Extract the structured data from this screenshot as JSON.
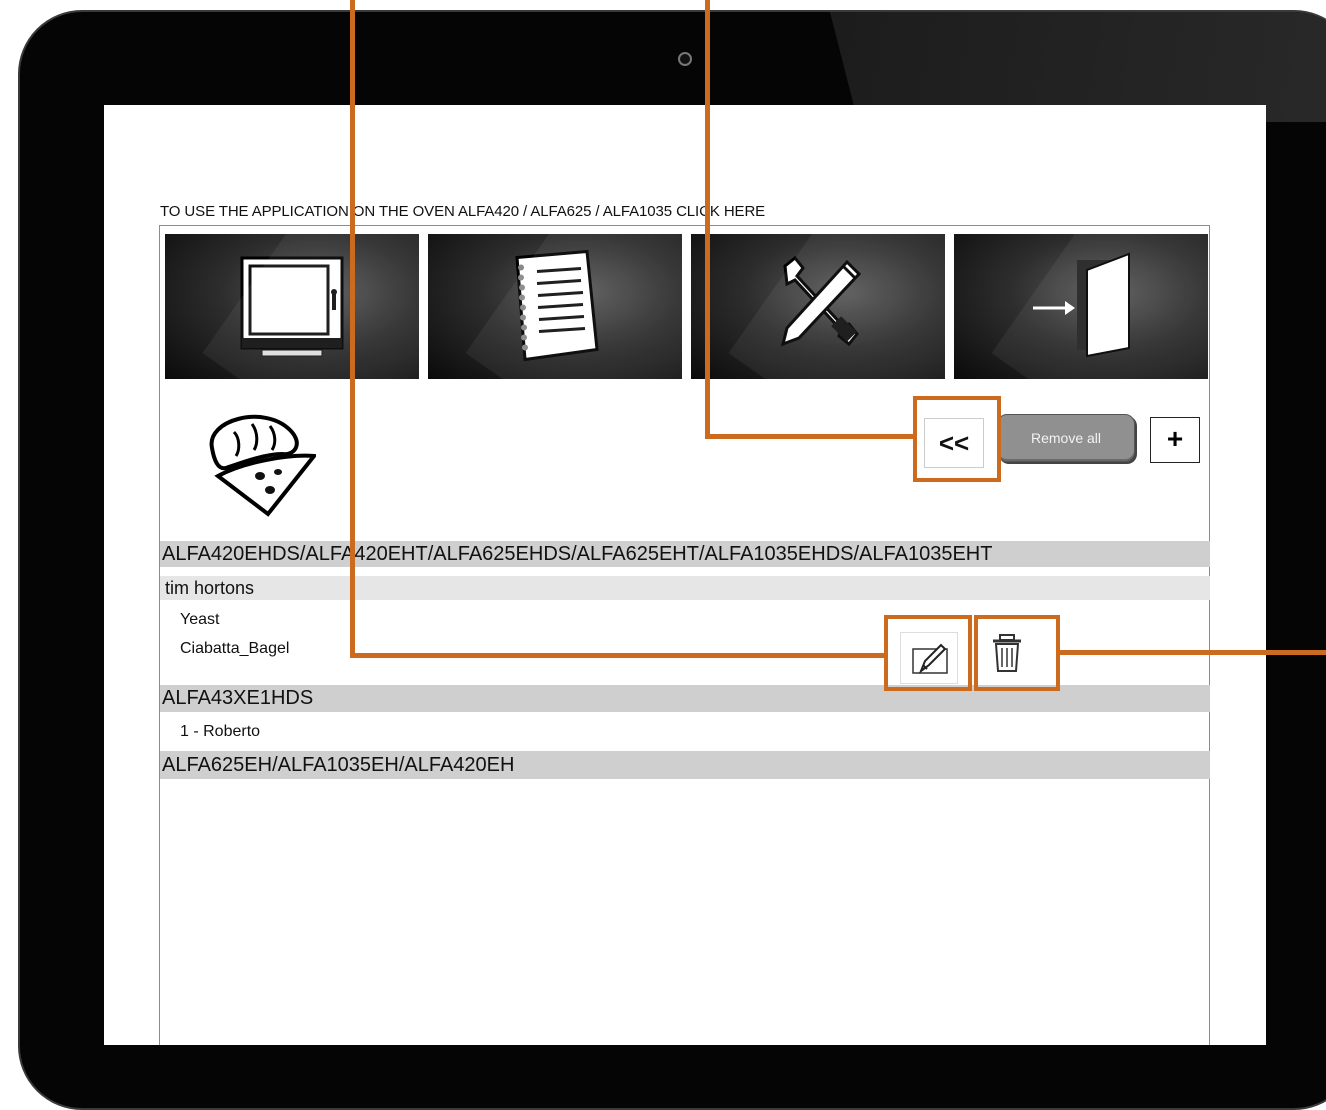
{
  "notice": {
    "text": "TO USE THE APPLICATION ON THE OVEN ALFA420 / ALFA625 / ALFA1035 CLICK HERE"
  },
  "toolbar": {
    "tiles": [
      {
        "icon": "oven-icon"
      },
      {
        "icon": "notebook-icon"
      },
      {
        "icon": "tools-icon"
      },
      {
        "icon": "exit-door-icon"
      }
    ]
  },
  "category": {
    "icon": "bread-pizza-icon"
  },
  "actions": {
    "back_label": "<<",
    "remove_all_label": "Remove all",
    "add_label": "+"
  },
  "groups": [
    {
      "model": "ALFA420EHDS/ALFA420EHT/ALFA625EHDS/ALFA625EHT/ALFA1035EHDS/ALFA1035EHT",
      "subgroup": "tim hortons",
      "items": [
        "Yeast",
        "Ciabatta_Bagel"
      ]
    },
    {
      "model": "ALFA43XE1HDS",
      "items": [
        "1 - Roberto"
      ]
    },
    {
      "model": "ALFA625EH/ALFA1035EH/ALFA420EH",
      "items": []
    }
  ],
  "item_actions": {
    "edit_icon": "pencil-icon",
    "delete_icon": "trash-icon"
  },
  "colors": {
    "callout": "#cc6a1e",
    "group_header_bg": "#cfcfcf",
    "subgroup_bg": "#e6e6e6",
    "device_bezel": "#050505"
  }
}
